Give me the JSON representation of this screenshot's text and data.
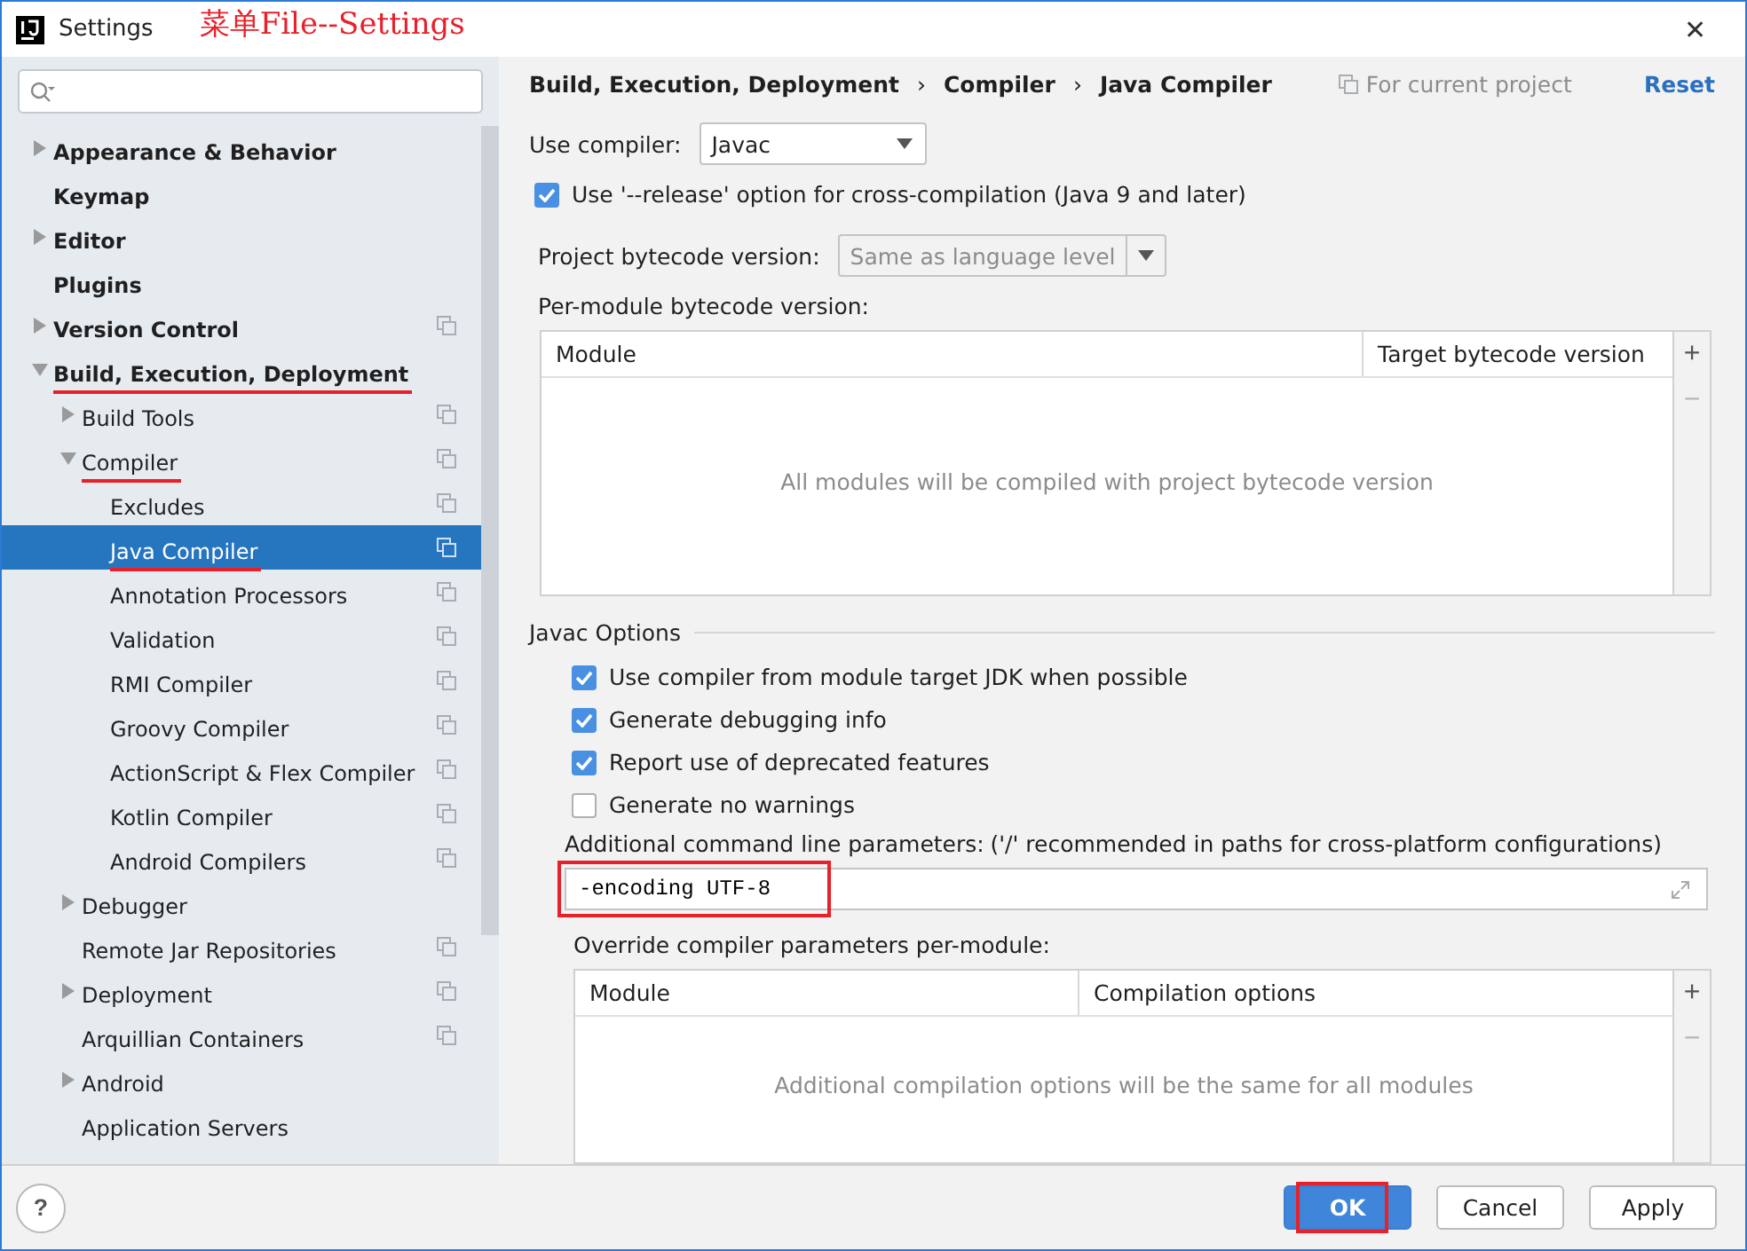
{
  "window": {
    "title": "Settings",
    "close": "✕"
  },
  "annotation": "菜单File--Settings",
  "tree": [
    {
      "label": "Appearance & Behavior",
      "expanded": false,
      "per_project": false,
      "selected": false,
      "underlined": false
    },
    {
      "label": "Keymap",
      "per_project": false,
      "selected": false,
      "underlined": false
    },
    {
      "label": "Editor",
      "expanded": false,
      "per_project": false,
      "selected": false,
      "underlined": false
    },
    {
      "label": "Plugins",
      "per_project": false,
      "selected": false,
      "underlined": false
    },
    {
      "label": "Version Control",
      "expanded": false,
      "per_project": true,
      "selected": false,
      "underlined": false
    },
    {
      "label": "Build, Execution, Deployment",
      "expanded": true,
      "per_project": false,
      "selected": false,
      "underlined": true,
      "children": [
        {
          "label": "Build Tools",
          "expanded": false,
          "per_project": true,
          "selected": false,
          "underlined": false
        },
        {
          "label": "Compiler",
          "expanded": true,
          "per_project": true,
          "selected": false,
          "underlined": true,
          "children": [
            {
              "label": "Excludes",
              "per_project": true,
              "selected": false,
              "underlined": false
            },
            {
              "label": "Java Compiler",
              "per_project": true,
              "selected": true,
              "underlined": true
            },
            {
              "label": "Annotation Processors",
              "per_project": true,
              "selected": false,
              "underlined": false
            },
            {
              "label": "Validation",
              "per_project": true,
              "selected": false,
              "underlined": false
            },
            {
              "label": "RMI Compiler",
              "per_project": true,
              "selected": false,
              "underlined": false
            },
            {
              "label": "Groovy Compiler",
              "per_project": true,
              "selected": false,
              "underlined": false
            },
            {
              "label": "ActionScript & Flex Compiler",
              "per_project": true,
              "selected": false,
              "underlined": false
            },
            {
              "label": "Kotlin Compiler",
              "per_project": true,
              "selected": false,
              "underlined": false
            },
            {
              "label": "Android Compilers",
              "per_project": true,
              "selected": false,
              "underlined": false
            }
          ]
        },
        {
          "label": "Debugger",
          "expanded": false,
          "per_project": false,
          "selected": false,
          "underlined": false
        },
        {
          "label": "Remote Jar Repositories",
          "per_project": true,
          "selected": false,
          "underlined": false
        },
        {
          "label": "Deployment",
          "expanded": false,
          "per_project": true,
          "selected": false,
          "underlined": false
        },
        {
          "label": "Arquillian Containers",
          "per_project": true,
          "selected": false,
          "underlined": false
        },
        {
          "label": "Android",
          "expanded": false,
          "per_project": false,
          "selected": false,
          "underlined": false
        },
        {
          "label": "Application Servers",
          "per_project": false,
          "selected": false,
          "underlined": false
        }
      ]
    }
  ],
  "breadcrumb": {
    "parts": [
      "Build, Execution, Deployment",
      "Compiler",
      "Java Compiler"
    ],
    "separator": "›",
    "scope": "For current project",
    "reset": "Reset"
  },
  "use_compiler": {
    "label": "Use compiler:",
    "value": "Javac"
  },
  "release_option": {
    "label": "Use '--release' option for cross-compilation (Java 9 and later)",
    "checked": true
  },
  "project_bytecode": {
    "label": "Project bytecode version:",
    "value": "Same as language level"
  },
  "module_bytecode": {
    "label": "Per-module bytecode version:",
    "columns": [
      "Module",
      "Target bytecode version"
    ],
    "empty_text": "All modules will be compiled with project bytecode version",
    "add": "+",
    "remove": "−"
  },
  "javac_options": {
    "title": "Javac Options",
    "checkboxes": [
      {
        "label": "Use compiler from module target JDK when possible",
        "checked": true
      },
      {
        "label": "Generate debugging info",
        "checked": true
      },
      {
        "label": "Report use of deprecated features",
        "checked": true
      },
      {
        "label": "Generate no warnings",
        "checked": false
      }
    ],
    "params_label": "Additional command line parameters:",
    "params_hint": "('/' recommended in paths for cross-platform configurations)",
    "params_value": "-encoding UTF-8",
    "params_highlighted": true
  },
  "override": {
    "label": "Override compiler parameters per-module:",
    "columns": [
      "Module",
      "Compilation options"
    ],
    "empty_text": "Additional compilation options will be the same for all modules",
    "add": "+",
    "remove": "−"
  },
  "footer": {
    "help": "?",
    "buttons": [
      {
        "label": "OK",
        "primary": true,
        "highlighted": true
      },
      {
        "label": "Cancel",
        "primary": false,
        "highlighted": false
      },
      {
        "label": "Apply",
        "primary": false,
        "highlighted": false
      }
    ]
  }
}
